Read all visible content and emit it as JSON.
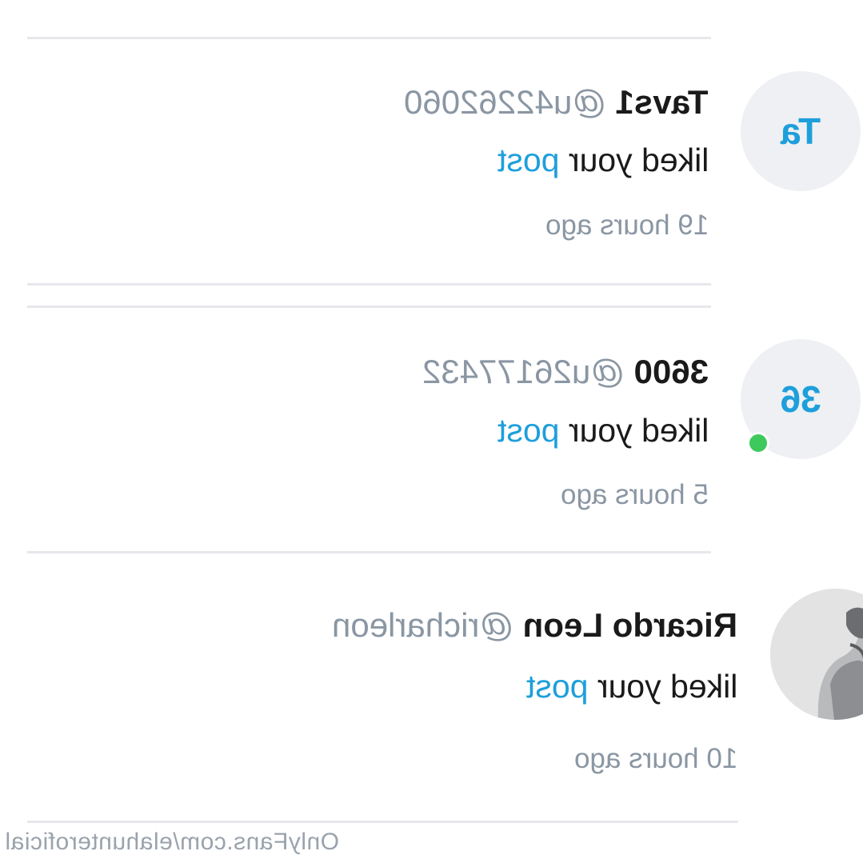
{
  "notifications": [
    {
      "name": "Tavs1",
      "handle": "@u42262060",
      "action": "liked your",
      "action_link": "post",
      "time": "19 hours ago",
      "avatar_initials": "Ta",
      "online": false
    },
    {
      "name": "3600",
      "handle": "@u26177432",
      "action": "liked your",
      "action_link": "post",
      "time": "5 hours ago",
      "avatar_initials": "36",
      "online": true
    },
    {
      "name": "Ricardo Leon",
      "handle": "@richarleon",
      "action": "liked your",
      "action_link": "post",
      "time": "10 hours ago",
      "avatar_initials": "",
      "online": false
    }
  ],
  "watermark": "OnlyFans.com/elahunteroficial",
  "colors": {
    "link": "#1e9fdb",
    "muted": "#8a96a3",
    "text": "#1a1a1a",
    "divider": "#e6e8ec",
    "online": "#3ec95c"
  }
}
